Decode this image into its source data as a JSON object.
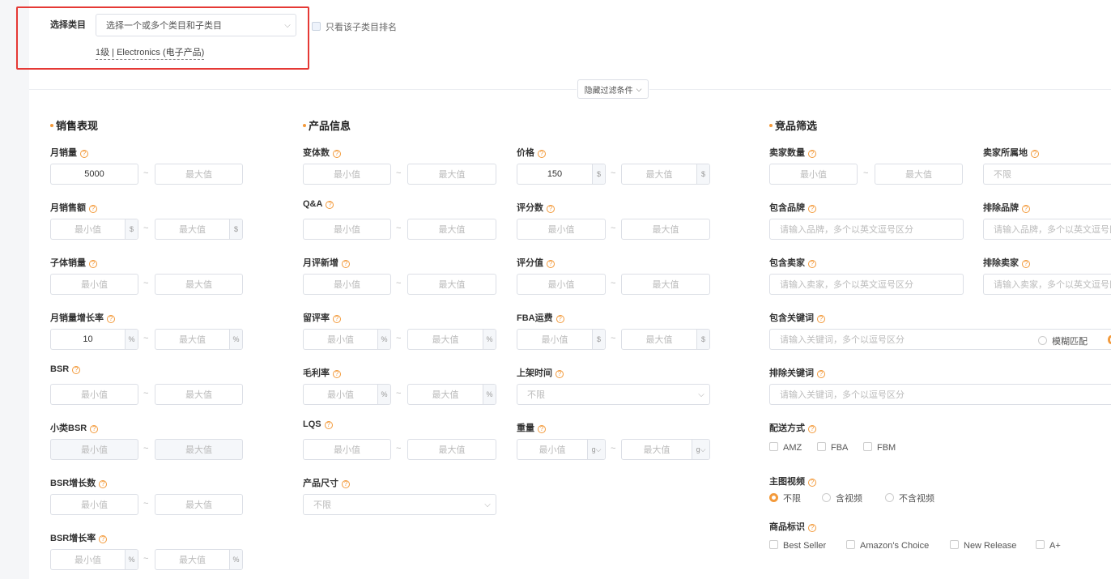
{
  "category": {
    "label": "选择类目",
    "select_placeholder": "选择一个或多个类目和子类目",
    "only_sub_label": "只看该子类目排名",
    "selected_tag": "1级 | Electronics (电子产品)"
  },
  "toggle_filters_label": "隐藏过滤条件",
  "common": {
    "min": "最小值",
    "max": "最大值",
    "unlimited": "不限",
    "tilde": "~",
    "q": "?"
  },
  "sales": {
    "title": "销售表现",
    "monthly_sales": {
      "label": "月销量",
      "min_value": "5000"
    },
    "monthly_revenue": {
      "label": "月销售额",
      "unit": "$"
    },
    "child_sales": {
      "label": "子体销量"
    },
    "sales_growth": {
      "label": "月销量增长率",
      "min_value": "10",
      "unit": "%"
    },
    "bsr": {
      "label": "BSR"
    },
    "sub_bsr": {
      "label": "小类BSR"
    },
    "bsr_growth_count": {
      "label": "BSR增长数"
    },
    "bsr_growth_rate": {
      "label": "BSR增长率",
      "unit": "%"
    }
  },
  "product": {
    "title": "产品信息",
    "variants": {
      "label": "变体数"
    },
    "qa": {
      "label": "Q&A"
    },
    "monthly_new_reviews": {
      "label": "月评新增"
    },
    "review_rate": {
      "label": "留评率",
      "unit": "%"
    },
    "gross_margin": {
      "label": "毛利率",
      "unit": "%"
    },
    "lqs": {
      "label": "LQS"
    },
    "size": {
      "label": "产品尺寸"
    },
    "price": {
      "label": "价格",
      "min_value": "150",
      "unit": "$"
    },
    "review_count": {
      "label": "评分数"
    },
    "rating": {
      "label": "评分值"
    },
    "fba_fee": {
      "label": "FBA运费",
      "unit": "$"
    },
    "listing_date": {
      "label": "上架时间"
    },
    "weight": {
      "label": "重量",
      "unit": "g"
    }
  },
  "competitor": {
    "title": "竞品筛选",
    "seller_count": {
      "label": "卖家数量"
    },
    "seller_location": {
      "label": "卖家所属地"
    },
    "include_brand": {
      "label": "包含品牌",
      "placeholder": "请输入品牌，多个以英文逗号区分"
    },
    "exclude_brand": {
      "label": "排除品牌",
      "placeholder": "请输入品牌，多个以英文逗号区"
    },
    "include_seller": {
      "label": "包含卖家",
      "placeholder": "请输入卖家，多个以英文逗号区分"
    },
    "exclude_seller": {
      "label": "排除卖家",
      "placeholder": "请输入卖家，多个以英文逗号区"
    },
    "include_keyword": {
      "label": "包含关键词",
      "placeholder": "请输入关键词，多个以逗号区分",
      "fuzzy": "模糊匹配"
    },
    "exclude_keyword": {
      "label": "排除关键词",
      "placeholder": "请输入关键词，多个以逗号区分"
    },
    "delivery": {
      "label": "配送方式",
      "options": [
        "AMZ",
        "FBA",
        "FBM"
      ]
    },
    "video": {
      "label": "主图视频",
      "options": [
        "不限",
        "含视频",
        "不含视频"
      ],
      "selected": "不限"
    },
    "badges": {
      "label": "商品标识",
      "options": [
        "Best Seller",
        "Amazon's Choice",
        "New Release",
        "A+"
      ]
    }
  },
  "colors": {
    "accent": "#f39a3b",
    "highlight_frame": "#e53935",
    "border": "#dcdfe6"
  }
}
